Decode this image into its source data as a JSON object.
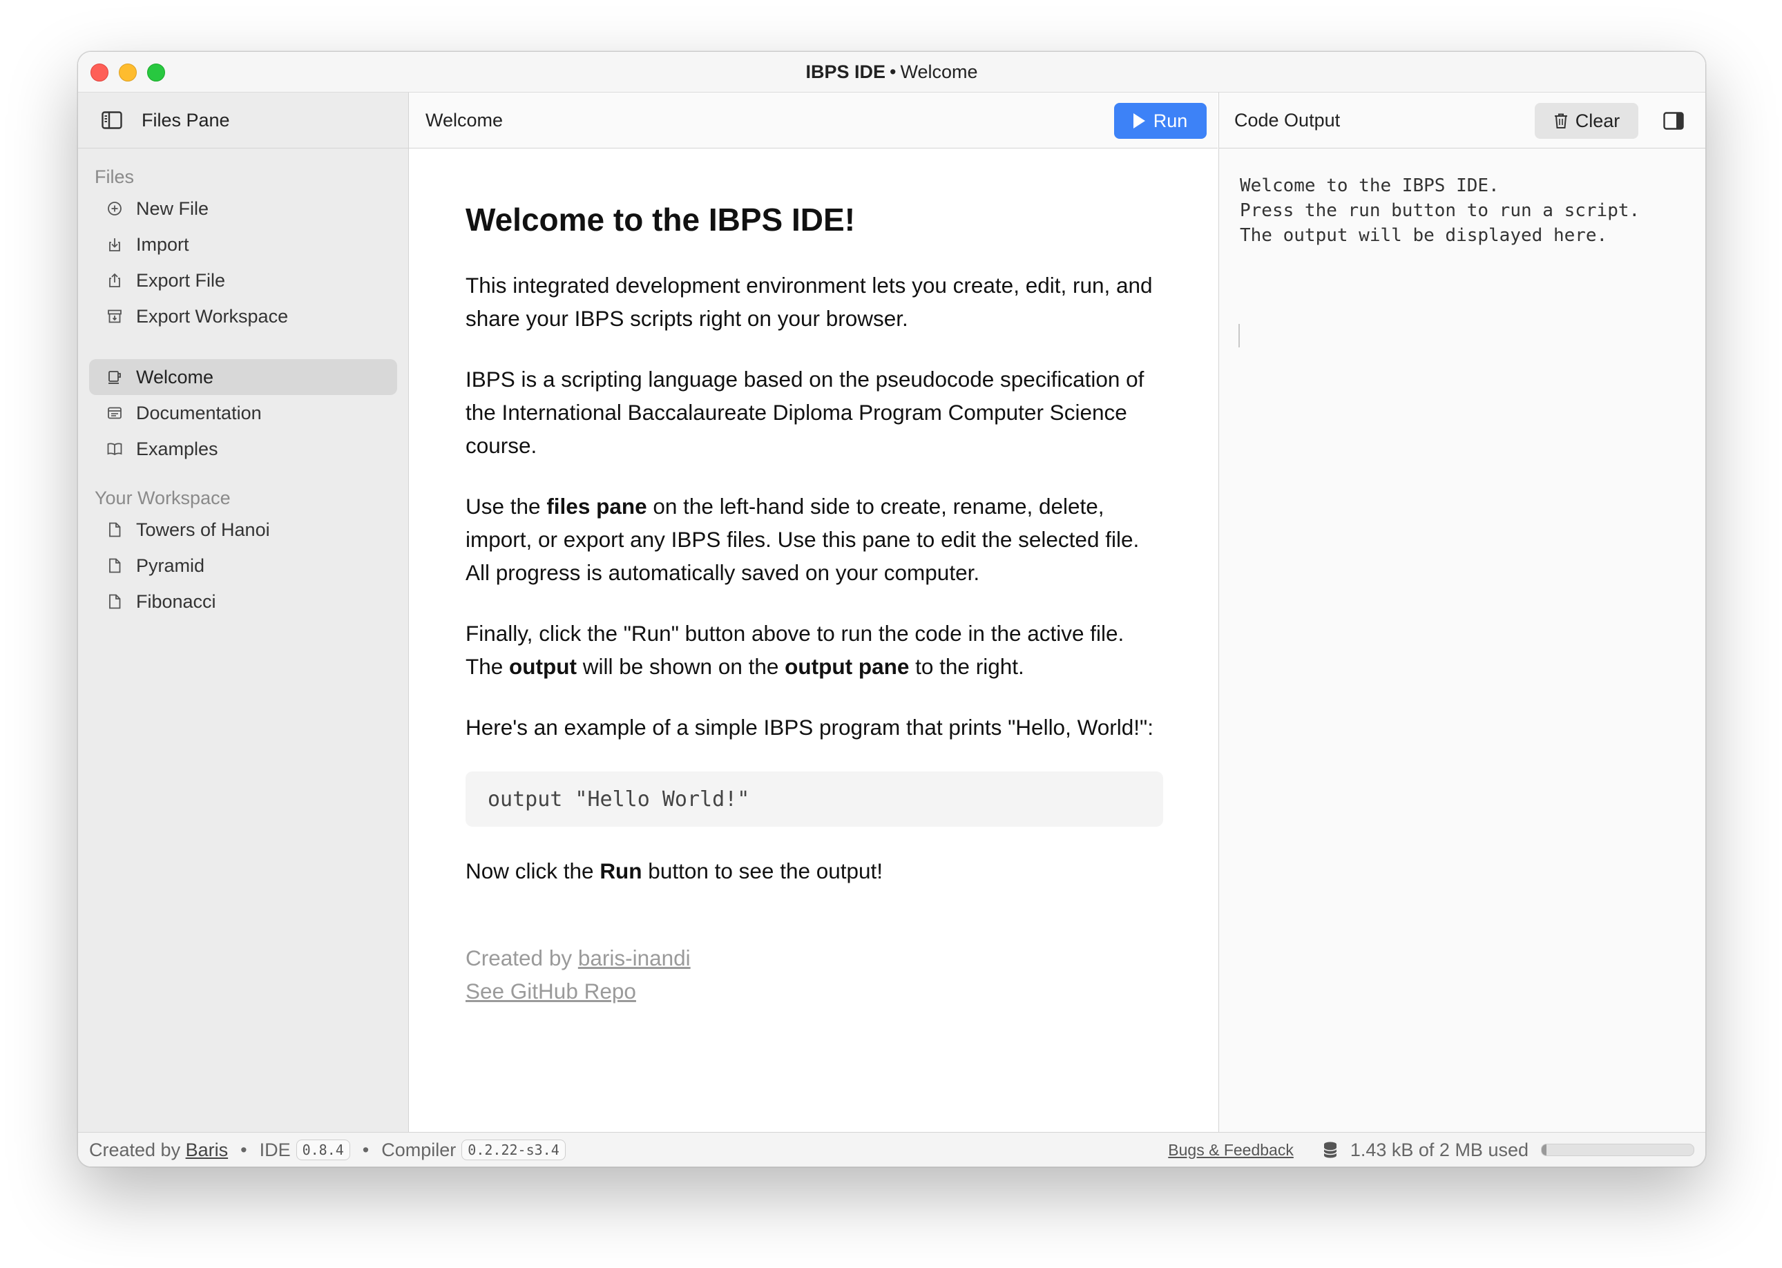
{
  "window": {
    "title": "IBPS IDE",
    "subtitle": "Welcome"
  },
  "sidebar": {
    "header": "Files Pane",
    "files_section": "Files",
    "file_actions": [
      {
        "label": "New File",
        "icon": "plus-circle-icon"
      },
      {
        "label": "Import",
        "icon": "import-icon"
      },
      {
        "label": "Export File",
        "icon": "share-icon"
      },
      {
        "label": "Export Workspace",
        "icon": "archive-icon"
      }
    ],
    "pages": [
      {
        "label": "Welcome",
        "icon": "cup-icon",
        "active": true
      },
      {
        "label": "Documentation",
        "icon": "docs-icon",
        "active": false
      },
      {
        "label": "Examples",
        "icon": "book-icon",
        "active": false
      }
    ],
    "workspace_section": "Your Workspace",
    "workspace_files": [
      {
        "label": "Towers of Hanoi",
        "icon": "file-icon"
      },
      {
        "label": "Pyramid",
        "icon": "file-icon"
      },
      {
        "label": "Fibonacci",
        "icon": "file-icon"
      }
    ]
  },
  "editor": {
    "tab_title": "Welcome",
    "run_label": "Run",
    "heading": "Welcome to the IBPS IDE!",
    "p1": "This integrated development environment lets you create, edit, run, and share your IBPS scripts right on your browser.",
    "p2": "IBPS is a scripting language based on the pseudocode specification of the International Baccalaureate Diploma Program Computer Science course.",
    "p3": {
      "a": "Use the ",
      "b": "files pane",
      "c": " on the left-hand side to create, rename, delete, import, or export any IBPS files. Use this pane to edit the selected file. All progress is automatically saved on your computer."
    },
    "p4": {
      "a": "Finally, click the \"Run\" button above to run the code in the active file. The ",
      "b": "output",
      "c": " will be shown on the ",
      "d": "output pane",
      "e": " to the right."
    },
    "p5": "Here's an example of a simple IBPS program that prints \"Hello, World!\":",
    "code": "output \"Hello World!\"",
    "p6": {
      "a": "Now click the ",
      "b": "Run",
      "c": " button to see the output!"
    },
    "created_by_prefix": "Created by ",
    "created_by_link": "baris-inandi",
    "repo_link": "See GitHub Repo"
  },
  "output": {
    "title": "Code Output",
    "clear_label": "Clear",
    "text": "Welcome to the IBPS IDE.\nPress the run button to run a script.\nThe output will be displayed here."
  },
  "status": {
    "created_by_prefix": "Created by",
    "author": "Baris",
    "ide_label": "IDE",
    "ide_version": "0.8.4",
    "compiler_label": "Compiler",
    "compiler_version": "0.2.22-s3.4",
    "bugs_label": "Bugs & Feedback",
    "storage_text": "1.43 kB of 2 MB used",
    "storage_fraction": 0.0007
  },
  "colors": {
    "accent": "#3d82f7",
    "sidebar_bg": "#ececec",
    "active_item": "#d8d8d8"
  }
}
